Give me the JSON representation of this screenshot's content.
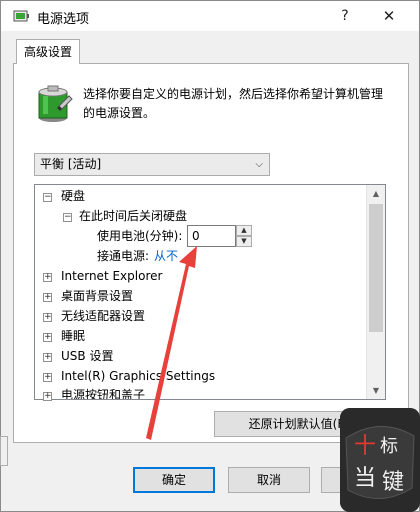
{
  "window": {
    "title": "电源选项",
    "help_glyph": "?",
    "close_glyph": "✕"
  },
  "tab": {
    "label": "高级设置"
  },
  "intro": {
    "text": "选择你要自定义的电源计划，然后选择你希望计算机管理的电源设置。"
  },
  "plan_select": {
    "value": "平衡 [活动]"
  },
  "tree": {
    "items": [
      {
        "label": "硬盘",
        "expander": "⊟"
      },
      {
        "label": "在此时间后关闭硬盘",
        "expander": "⊟"
      },
      {
        "label": "使用电池(分钟):"
      },
      {
        "label": "接通电源:",
        "value": "从不"
      },
      {
        "label": "Internet Explorer",
        "expander": "+"
      },
      {
        "label": "桌面背景设置",
        "expander": "+"
      },
      {
        "label": "无线适配器设置",
        "expander": "+"
      },
      {
        "label": "睡眠",
        "expander": "+"
      },
      {
        "label": "USB 设置",
        "expander": "+"
      },
      {
        "label": "Intel(R) Graphics Settings",
        "expander": "+"
      },
      {
        "label": "电源按钮和盖子",
        "expander": "+"
      }
    ],
    "battery_minutes": "0"
  },
  "buttons": {
    "restore": "还原计划默认值(R)",
    "ok": "确定",
    "cancel": "取消",
    "apply": "应"
  },
  "watermark": {
    "chars": [
      "十",
      "标",
      "当",
      "键"
    ]
  },
  "colors": {
    "link": "#0066cc",
    "arrow": "#e8403a",
    "accent": "#0078d7"
  },
  "icons": {
    "scroll_up": "▲",
    "scroll_down": "▼",
    "spin_up": "▲",
    "spin_down": "▼",
    "chevron": "⌵"
  }
}
